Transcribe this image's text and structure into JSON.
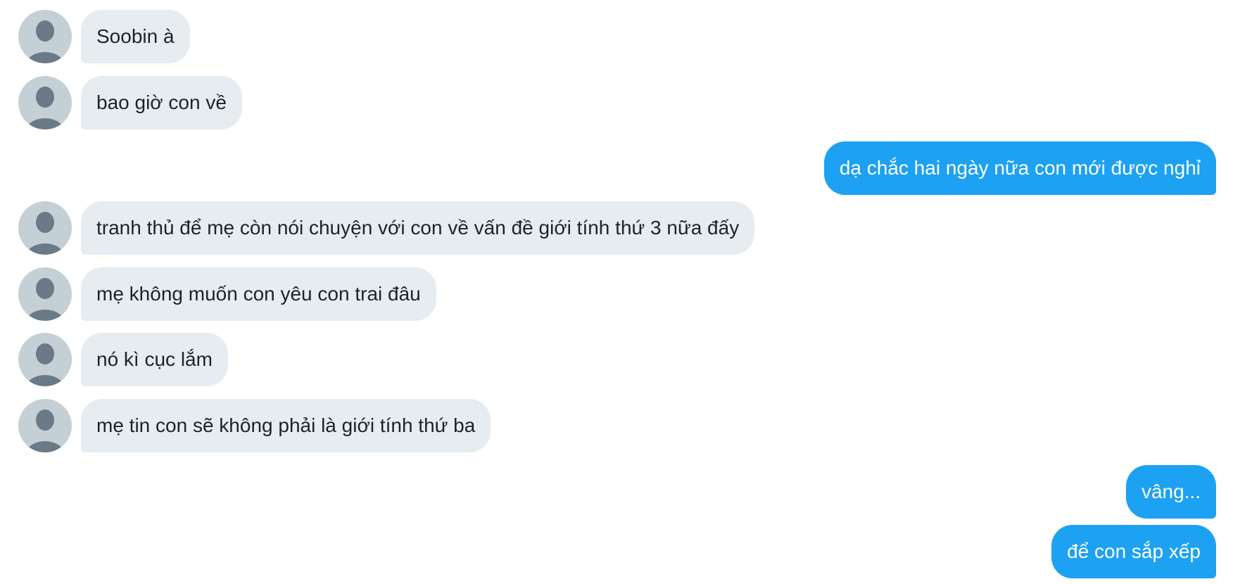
{
  "conversation": {
    "messages": [
      {
        "from": "contact",
        "text": "Soobin à"
      },
      {
        "from": "contact",
        "text": "bao giờ con về"
      },
      {
        "from": "me",
        "text": "dạ chắc hai ngày nữa con mới được nghỉ"
      },
      {
        "from": "contact",
        "text": "tranh thủ để mẹ còn nói chuyện với con về vấn đề giới tính thứ 3 nữa đấy"
      },
      {
        "from": "contact",
        "text": "mẹ không muốn con yêu con trai đâu"
      },
      {
        "from": "contact",
        "text": "nó kì cục lắm"
      },
      {
        "from": "contact",
        "text": "mẹ tin con sẽ không phải là giới tính thứ ba"
      },
      {
        "from": "me",
        "text": "vâng..."
      },
      {
        "from": "me",
        "text": "để con sắp xếp"
      }
    ]
  },
  "style": {
    "incoming_bubble_color": "#e6ecf0",
    "outgoing_bubble_color": "#1da1f2",
    "avatar_color": "#c5d0d6",
    "avatar_icon": "default-person-icon"
  }
}
